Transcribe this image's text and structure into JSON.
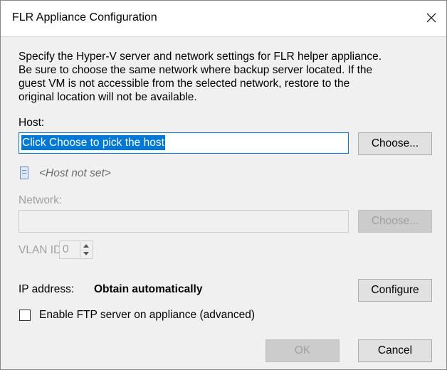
{
  "dialog": {
    "title": "FLR Appliance Configuration",
    "description": "Specify the Hyper-V server and network settings for FLR helper appliance.\nBe sure to choose the same network where backup server located. If the\nguest VM is not accessible from the selected network, restore to the\noriginal location will not be available."
  },
  "host": {
    "label": "Host:",
    "value": "Click Choose to pick the host",
    "choose_label": "Choose...",
    "status_text": "<Host not set>"
  },
  "network": {
    "label": "Network:",
    "value": "",
    "choose_label": "Choose..."
  },
  "vlan": {
    "label": "VLAN ID:",
    "value": "0"
  },
  "ip": {
    "label": "IP address:",
    "value": "Obtain automatically",
    "configure_label": "Configure"
  },
  "ftp": {
    "label": "Enable FTP server on appliance (advanced)",
    "checked": false
  },
  "footer": {
    "ok_label": "OK",
    "cancel_label": "Cancel"
  },
  "colors": {
    "accent": "#0078d7",
    "disabled_text": "#a0a0a0",
    "background": "#f0f0f0"
  },
  "icons": {
    "close": "close-icon",
    "host": "server-icon",
    "spin_up": "chevron-up-icon",
    "spin_down": "chevron-down-icon"
  }
}
